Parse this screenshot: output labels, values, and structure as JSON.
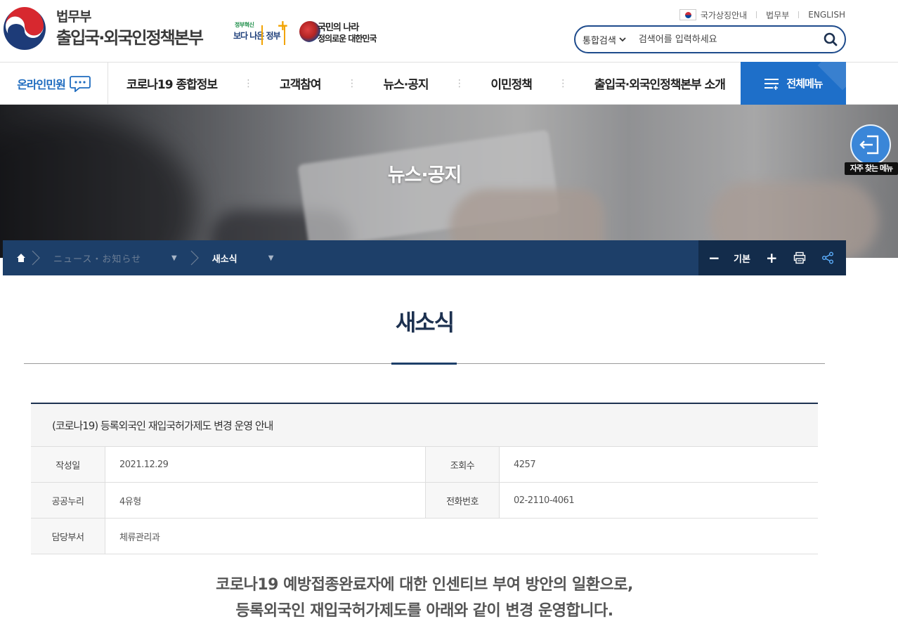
{
  "header": {
    "org_small": "법무부",
    "org_main": "출입국·외국인정책본부",
    "badge_gov_small": "정부혁신",
    "badge_gov_main": "보다 나은 정부",
    "badge_nation_line1": "국민의 나라",
    "badge_nation_line2": "정의로운 대한민국",
    "util_links": [
      "국가상징안내",
      "법무부",
      "ENGLISH"
    ],
    "search": {
      "scope": "통합검색",
      "placeholder": "검색어를 입력하세요"
    }
  },
  "nav": {
    "online": "온라인민원",
    "items": [
      "코로나19 종합정보",
      "고객참여",
      "뉴스·공지",
      "이민정책",
      "출입국·외국인정책본부 소개"
    ],
    "all_menu": "전체메뉴"
  },
  "hero": {
    "title": "뉴스·공지"
  },
  "quick": {
    "label": "자주 찾는 메뉴"
  },
  "breadcrumb": {
    "level1": "ニュース・お知らせ",
    "level2": "새소식",
    "zoom_label": "기본"
  },
  "page": {
    "title": "새소식"
  },
  "post": {
    "subject": "(코로나19) 등록외국인 재입국허가제도 변경 운영 안내",
    "fields": {
      "date_label": "작성일",
      "date_value": "2021.12.29",
      "views_label": "조회수",
      "views_value": "4257",
      "license_label": "공공누리",
      "license_value": "4유형",
      "phone_label": "전화번호",
      "phone_value": "02-2110-4061",
      "dept_label": "담당부서",
      "dept_value": "체류관리과"
    },
    "body_line1": "코로나19 예방접종완료자에 대한 인센티브 부여 방안의 일환으로,",
    "body_line2": "등록외국인 재입국허가제도를 아래와 같이 변경 운영합니다."
  },
  "colors": {
    "brand_blue": "#1e6fc9",
    "navy": "#1d3f69",
    "title_navy": "#1d3150"
  },
  "icons": {
    "search": "search-icon",
    "home": "home-icon",
    "print": "print-icon",
    "share": "share-icon",
    "menu": "hamburger-icon",
    "chat": "chat-bubble-icon",
    "exit": "exit-arrow-icon"
  }
}
